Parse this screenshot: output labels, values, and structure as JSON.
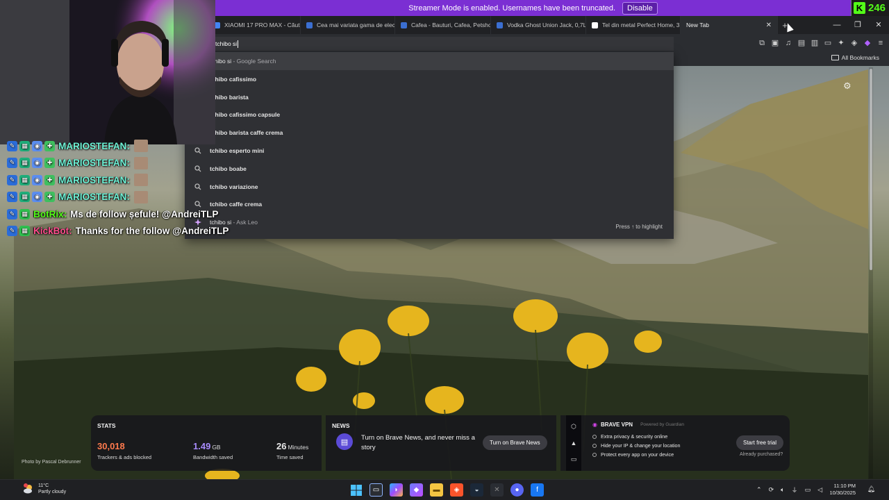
{
  "streamer_banner": {
    "text": "Streamer Mode is enabled. Usernames have been truncated.",
    "button_label": "Disable",
    "color": "#7b2fd3"
  },
  "kick_badge": {
    "logo": "K",
    "count": "246",
    "color": "#53fc18"
  },
  "browser": {
    "tabs": [
      {
        "label": "XIAOMI 17 PRO MAX - Căutare",
        "color": "#4285f4"
      },
      {
        "label": "Cea mai variata gama de electro",
        "color": "#3b6fd1"
      },
      {
        "label": "Cafea - Bauturi, Cafea, Petshop",
        "color": "#3b6fd1"
      },
      {
        "label": "Vodka Ghost Union Jack, 0,7L",
        "color": "#3b6fd1"
      },
      {
        "label": "Tel din metal Perfect Home, 33",
        "color": "#ffffff"
      },
      {
        "label": "New Tab",
        "active": true
      }
    ],
    "tab_close": "✕",
    "new_tab": "+",
    "window_controls": {
      "minimize": "—",
      "restore": "❐",
      "close": "✕"
    },
    "omnibox": {
      "value": "tchibo si",
      "suggestions": [
        {
          "typed": "tchibo si",
          "source": " - Google Search",
          "icon": "google-icon",
          "highlighted": true
        },
        {
          "typed": "tchibo cafissimo",
          "icon": "search-icon"
        },
        {
          "typed": "tchibo barista",
          "icon": "search-icon"
        },
        {
          "typed": "tchibo cafissimo capsule",
          "icon": "search-icon"
        },
        {
          "typed": "tchibo barista caffe crema",
          "icon": "search-icon"
        },
        {
          "typed": "tchibo esperto mini",
          "icon": "search-icon"
        },
        {
          "typed": "tchibo boabe",
          "icon": "search-icon"
        },
        {
          "typed": "tchibo variazione",
          "icon": "search-icon"
        },
        {
          "typed": "tchibo caffe crema",
          "icon": "search-icon"
        },
        {
          "typed": "tchibo si",
          "source": " - Ask Leo",
          "icon": "leo-icon"
        }
      ],
      "footer_hint": "Press ↑ to highlight"
    },
    "all_bookmarks": "All Bookmarks"
  },
  "chat": [
    {
      "user": "MARIOSTEFAN:",
      "msg": "",
      "color": "#6df2d6",
      "emote": true,
      "badges": 4
    },
    {
      "user": "MARIOSTEFAN:",
      "msg": "",
      "color": "#6df2d6",
      "emote": true,
      "badges": 4
    },
    {
      "user": "MARIOSTEFAN:",
      "msg": "",
      "color": "#6df2d6",
      "emote": true,
      "badges": 4
    },
    {
      "user": "MARIOSTEFAN:",
      "msg": "",
      "color": "#6df2d6",
      "emote": true,
      "badges": 4
    },
    {
      "user": "BotRix:",
      "msg": "Ms de follow șefule! @AndreiTLP",
      "color": "#53fc18",
      "badges": 2
    },
    {
      "user": "KickBot:",
      "msg": "Thanks for the follow @AndreiTLP",
      "color": "#ff4d8d",
      "badges": 2
    }
  ],
  "new_tab_page": {
    "photo_credit": "Photo by Pascal Debrunner",
    "stats": {
      "title": "STATS",
      "trackers": {
        "value": "30,018",
        "label": "Trackers & ads blocked",
        "color": "#ff7a4d"
      },
      "bandwidth": {
        "value": "1.49",
        "unit": "GB",
        "label": "Bandwidth saved",
        "color": "#a78bfa"
      },
      "time": {
        "value": "26",
        "unit": "Minutes",
        "label": "Time saved",
        "color": "#ffffff"
      }
    },
    "news": {
      "title": "NEWS",
      "text": "Turn on Brave News, and never miss a story",
      "button": "Turn on Brave News"
    },
    "vpn": {
      "title": "BRAVE VPN",
      "powered_by": "Powered by Guardian",
      "features": [
        "Extra privacy & security online",
        "Hide your IP & change your location",
        "Protect every app on your device"
      ],
      "button": "Start free trial",
      "already": "Already purchased?"
    }
  },
  "taskbar": {
    "weather": {
      "temp": "11°C",
      "desc": "Partly cloudy",
      "alert": "1"
    },
    "time": "11:10 PM",
    "date": "10/30/2025"
  }
}
